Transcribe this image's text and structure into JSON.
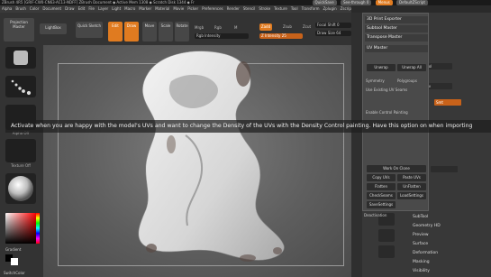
{
  "titlebar": {
    "title": "ZBrush 4R5 [GRIF-CW0-CN63-AC13-NDFF]    ZBrush Document    ◆ Active Mem 1308 ◆ Scratch Disk 1344 ◆ Fr",
    "quicksave": "QuickSave",
    "seethrough": "See-through 0",
    "menus": "Menus",
    "default_script": "DefaultZScript"
  },
  "menubar": {
    "items": [
      "Alpha",
      "Brush",
      "Color",
      "Document",
      "Draw",
      "Edit",
      "File",
      "Layer",
      "Light",
      "Macro",
      "Marker",
      "Material",
      "Movie",
      "Picker",
      "Preferences",
      "Render",
      "Stencil",
      "Stroke",
      "Texture",
      "Tool",
      "Transform",
      "Zplugin",
      "Zscript"
    ]
  },
  "shelf": {
    "projection_master": "Projection Master",
    "lightbox": "LightBox",
    "quick_sketch": "Quick Sketch",
    "edit": "Edit",
    "draw": "Draw",
    "move": "Move",
    "scale": "Scale",
    "rotate": "Rotate",
    "mrgb": "Mrgb",
    "rgb": "Rgb",
    "m": "M",
    "rgb_intensity": "Rgb Intensity",
    "zadd": "Zadd",
    "zsub": "Zsub",
    "zcut": "Zcut",
    "z_intensity": "Z Intensity 25",
    "focal_shift": "Focal Shift 0",
    "draw_size": "Draw Size 64",
    "dynamic": "Dynamic"
  },
  "leftcol": {
    "alpha_off": "Alpha Off",
    "texture_off": "Texture Off",
    "gradient": "Gradient",
    "switch_color": "SwitchColor"
  },
  "tooltip": {
    "text": "Activate when you are happy with the model's UVs and want to change the Density of the UVs with the Density Control painting. Have this option on when importing"
  },
  "palette": {
    "item1": "3D Print Exporter",
    "item2": "Subtool Master",
    "item3": "Transpose Master",
    "item4": "UV Master",
    "unwrap": "Unwrap",
    "unwrap_all": "Unwrap All",
    "symmetry": "Symmetry",
    "polygroups": "Polygroups",
    "use_existing": "Use Existing UV Seams",
    "enable_control": "Enable Control Painting",
    "work_on_clone": "Work On Clone",
    "copy_uvs": "Copy UVs",
    "paste_uvs": "Paste UVs",
    "flatten": "Flatten",
    "unflatten": "UnFlatten",
    "checkseams": "CheckSeams",
    "load_settings": "LoadSettings",
    "save_settings": "SaveSettings"
  },
  "rightpanel": {
    "subtool": "SubTool",
    "geometry_hd": "Geometry HD",
    "preview": "Preview",
    "surface": "Surface",
    "deformation": "Deformation",
    "masking": "Masking",
    "visibility": "Visibility",
    "deactivation": "Deactivation",
    "subdiv": "SubDiv",
    "smt": "Smt"
  },
  "colors": {
    "accent": "#e07b20"
  }
}
